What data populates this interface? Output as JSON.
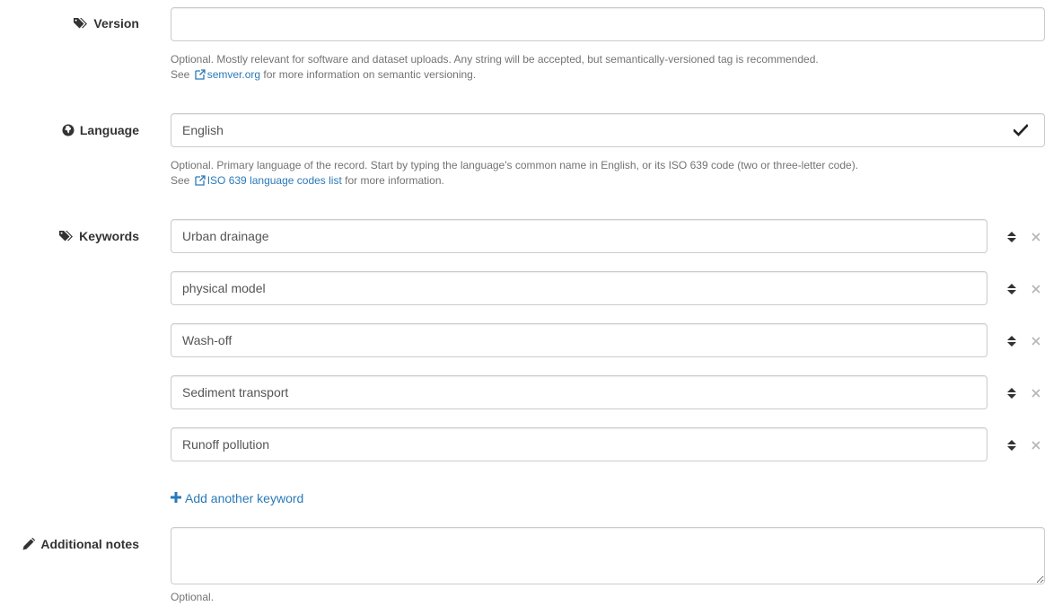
{
  "version": {
    "label": "Version",
    "value": "",
    "help_line1": "Optional. Mostly relevant for software and dataset uploads. Any string will be accepted, but semantically-versioned tag is recommended.",
    "help_see": "See",
    "help_link": "semver.org",
    "help_rest": "for more information on semantic versioning."
  },
  "language": {
    "label": "Language",
    "value": "English",
    "help_line1": "Optional. Primary language of the record. Start by typing the language's common name in English, or its ISO 639 code (two or three-letter code).",
    "help_see": "See",
    "help_link": "ISO 639 language codes list",
    "help_rest": "for more information."
  },
  "keywords": {
    "label": "Keywords",
    "items": [
      "Urban drainage",
      "physical model",
      "Wash-off",
      "Sediment transport",
      "Runoff pollution"
    ],
    "add_label": "Add another keyword"
  },
  "notes": {
    "label": "Additional notes",
    "value": "",
    "help": "Optional."
  },
  "colors": {
    "link": "#2a7ab8",
    "help_text": "#737373",
    "border": "#cccccc"
  }
}
